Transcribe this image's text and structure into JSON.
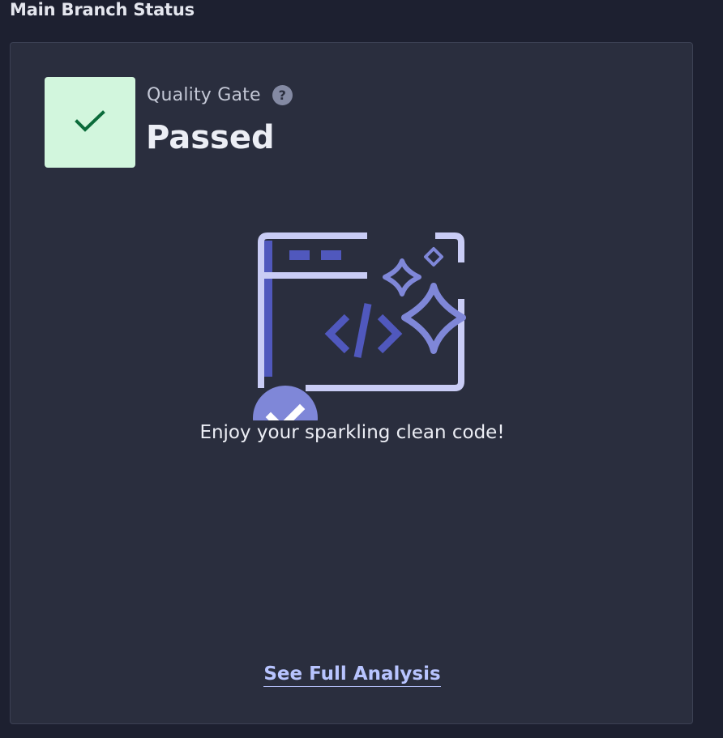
{
  "section": {
    "title": "Main Branch Status"
  },
  "quality_gate": {
    "label": "Quality Gate",
    "help_symbol": "?",
    "status": "Passed",
    "status_icon": "checkmark-icon",
    "status_color": "#0b6b3a",
    "status_bg": "#d2f6dd"
  },
  "empty_state": {
    "illustration": "sparkling-code-window-illustration",
    "message": "Enjoy your sparkling clean code!"
  },
  "actions": {
    "see_full_analysis": "See Full Analysis"
  },
  "colors": {
    "background": "#1d2030",
    "card": "#2a2e3e",
    "accent": "#b8c4ff",
    "illustration_dark": "#5058bd",
    "illustration_mid": "#7f87d8",
    "illustration_light": "#c9ccf5"
  }
}
